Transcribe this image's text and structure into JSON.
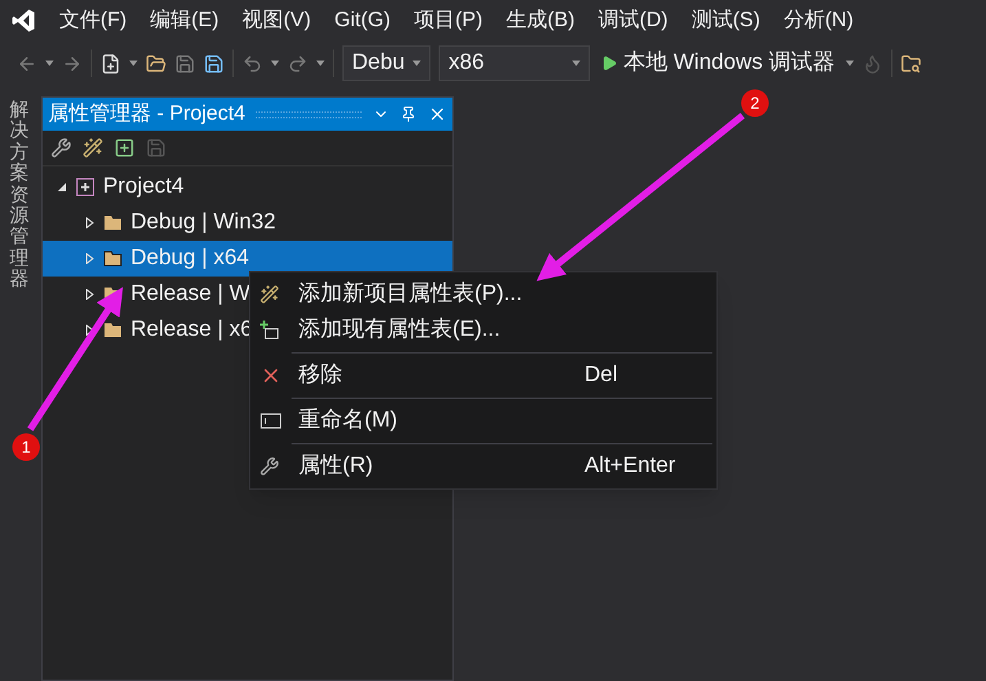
{
  "menu_bar": [
    "文件(F)",
    "编辑(E)",
    "视图(V)",
    "Git(G)",
    "项目(P)",
    "生成(B)",
    "调试(D)",
    "测试(S)",
    "分析(N)"
  ],
  "toolbar": {
    "configuration": "Debu",
    "platform": "x86",
    "debugger": "本地 Windows 调试器"
  },
  "side_tab": "解决方案资源管理器",
  "panel": {
    "title": "属性管理器 - Project4",
    "tree": {
      "label": "Project4",
      "expanded": true,
      "children": [
        {
          "label": "Debug | Win32",
          "selected": false,
          "expanded": false
        },
        {
          "label": "Debug | x64",
          "selected": true,
          "expanded": false
        },
        {
          "label": "Release | W",
          "selected": false,
          "expanded": false
        },
        {
          "label": "Release | x6",
          "selected": false,
          "expanded": false
        }
      ]
    }
  },
  "context_menu": [
    {
      "kind": "item",
      "label": "添加新项目属性表(P)..."
    },
    {
      "kind": "item",
      "label": "添加现有属性表(E)..."
    },
    {
      "kind": "separator"
    },
    {
      "kind": "item",
      "label": "移除",
      "shortcut": "Del"
    },
    {
      "kind": "separator"
    },
    {
      "kind": "item",
      "label": "重命名(M)"
    },
    {
      "kind": "separator"
    },
    {
      "kind": "item",
      "label": "属性(R)",
      "shortcut": "Alt+Enter"
    }
  ],
  "annotations": [
    {
      "label": "1"
    },
    {
      "label": "2"
    }
  ]
}
